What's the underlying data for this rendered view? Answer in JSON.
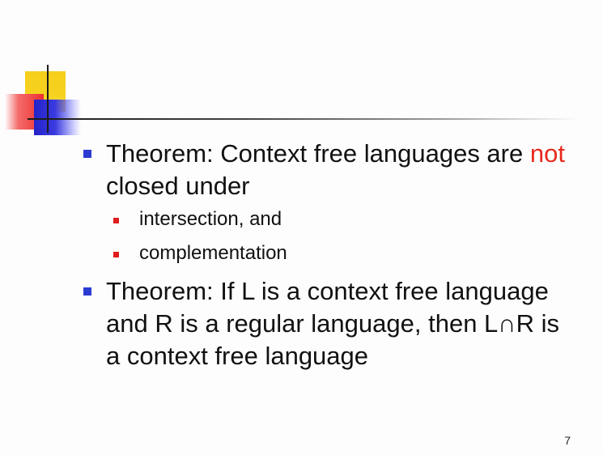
{
  "slide": {
    "bullets": [
      {
        "text_before": "Theorem: Context free languages are ",
        "text_emph": "not",
        "text_after": " closed under",
        "sub_items": [
          "intersection, and",
          "complementation"
        ]
      },
      {
        "text": "Theorem: If L is a context free language and R is a regular language, then L∩R is a context free language"
      }
    ],
    "page_number": "7"
  },
  "colors": {
    "bullet_primary": "#2b3ad1",
    "bullet_secondary": "#e01c1c",
    "emphasis": "#e8291f",
    "logo_yellow": "#f5cf1c",
    "logo_red": "#ee2f2f",
    "logo_blue": "#2323c8"
  }
}
